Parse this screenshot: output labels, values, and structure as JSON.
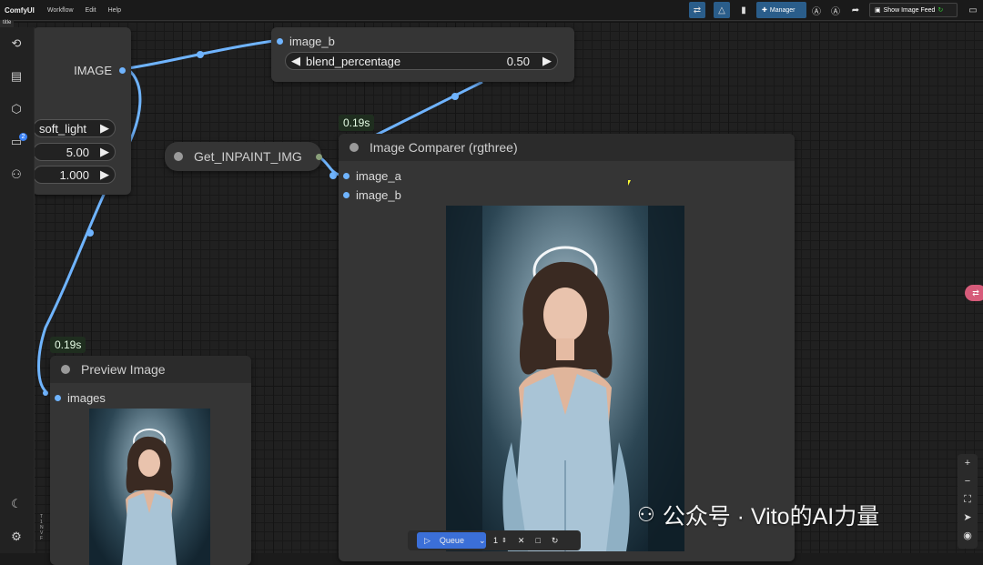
{
  "app": {
    "brand": "ComfyUI",
    "menus": [
      "Workflow",
      "Edit",
      "Help"
    ],
    "tab_label": "title",
    "manager_label": "Manager",
    "show_feed_label": "Show Image Feed"
  },
  "sidebar": {
    "badge_count": "2",
    "icons": [
      "history-icon",
      "queue-list-icon",
      "model-cube-icon",
      "workflow-folder-icon",
      "node-library-icon",
      "theme-moon-icon",
      "settings-gear-icon"
    ]
  },
  "nodes": {
    "left_partial": {
      "output_label": "IMAGE",
      "widgets": [
        {
          "value": "soft_light"
        },
        {
          "value": "5.00"
        },
        {
          "value": "1.000"
        }
      ]
    },
    "blend_partial": {
      "input_label": "image_b",
      "widget_name": "blend_percentage",
      "widget_value": "0.50"
    },
    "get_node": {
      "title": "Get_INPAINT_IMG"
    },
    "comparer": {
      "title": "Image Comparer (rgthree)",
      "inputs": [
        "image_a",
        "image_b"
      ],
      "timing": "0.19s"
    },
    "preview": {
      "title": "Preview Image",
      "input": "images",
      "timing": "0.19s"
    }
  },
  "queue": {
    "label": "Queue",
    "count": "1"
  },
  "watermark": "公众号 · Vito的AI力量",
  "colors": {
    "wire": "#6fb4ff",
    "accent": "#2a5d8a",
    "queue": "#3b6fd8"
  }
}
